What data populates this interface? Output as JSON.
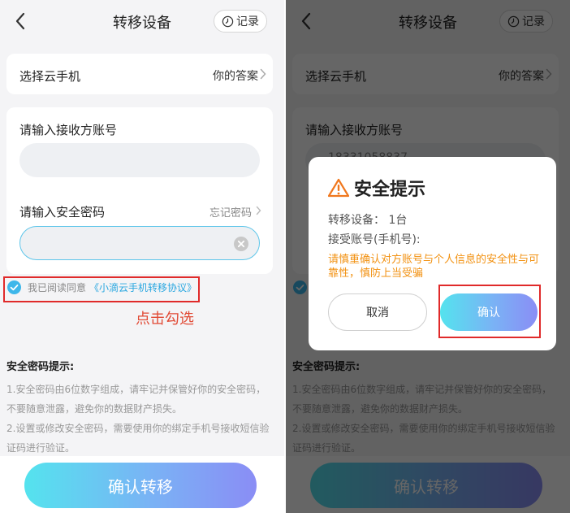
{
  "screen": {
    "title": "转移设备",
    "record_label": "记录",
    "select_phone": {
      "label": "选择云手机",
      "value": "你的答案"
    },
    "receiver": {
      "label": "请输入接收方账号",
      "value": "",
      "partial_value_right": "18331058837"
    },
    "password": {
      "label": "请输入安全密码",
      "forgot_label": "忘记密码",
      "value": ""
    },
    "agreement": {
      "prefix": "我已阅读同意",
      "link": "《小滴云手机转移协议》"
    },
    "annotation": "点击勾选",
    "tips": {
      "title": "安全密码提示:",
      "items": [
        "1.安全密码由6位数字组成，请牢记并保管好你的安全密码，不要随意泄露，避免你的数据财产损失。",
        "2.设置或修改安全密码，需要使用你的绑定手机号接收短信验证码进行验证。"
      ]
    },
    "confirm_transfer_label": "确认转移"
  },
  "dialog": {
    "title": "安全提示",
    "device_line": "转移设备：  1台",
    "account_line": "接受账号(手机号):",
    "warning": "请慎重确认对方账号与个人信息的安全性与可靠性，慎防上当受骗",
    "cancel_label": "取消",
    "confirm_label": "确认"
  },
  "colors": {
    "accent_blue": "#2aa7e0",
    "gradient_start": "#54e3ee",
    "gradient_end": "#8a8df5",
    "annotation_red": "#e14a35",
    "warning_orange": "#f29111"
  },
  "icons": [
    "back-arrow-icon",
    "clock-icon",
    "chevron-right-icon",
    "clear-icon",
    "check-circle-icon",
    "warning-triangle-icon"
  ]
}
